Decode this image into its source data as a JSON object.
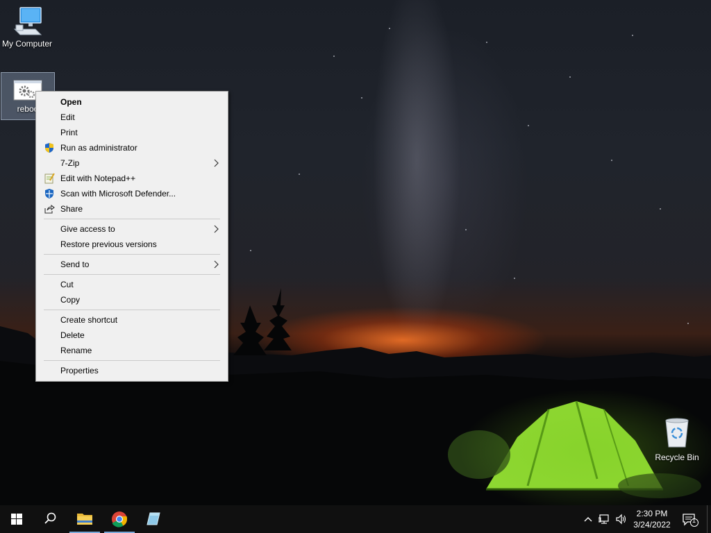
{
  "desktop": {
    "icons": [
      {
        "label": "My Computer",
        "icon": "computer-icon"
      },
      {
        "label": "reboo",
        "icon": "batch-file-gears-icon"
      },
      {
        "label": "Recycle Bin",
        "icon": "recycle-bin-icon"
      }
    ]
  },
  "context_menu": {
    "groups": [
      [
        {
          "label": "Open",
          "bold": true
        },
        {
          "label": "Edit"
        },
        {
          "label": "Print"
        },
        {
          "label": "Run as administrator",
          "icon": "uac-shield-icon"
        },
        {
          "label": "7-Zip",
          "submenu": true
        },
        {
          "label": "Edit with Notepad++",
          "icon": "notepad-plus-plus-icon"
        },
        {
          "label": "Scan with Microsoft Defender...",
          "icon": "defender-shield-icon"
        },
        {
          "label": "Share",
          "icon": "share-icon"
        }
      ],
      [
        {
          "label": "Give access to",
          "submenu": true
        },
        {
          "label": "Restore previous versions"
        }
      ],
      [
        {
          "label": "Send to",
          "submenu": true
        }
      ],
      [
        {
          "label": "Cut"
        },
        {
          "label": "Copy"
        }
      ],
      [
        {
          "label": "Create shortcut"
        },
        {
          "label": "Delete"
        },
        {
          "label": "Rename"
        }
      ],
      [
        {
          "label": "Properties"
        }
      ]
    ]
  },
  "taskbar": {
    "buttons": [
      {
        "name": "start-button",
        "icon": "windows-logo-icon"
      },
      {
        "name": "search-button",
        "icon": "search-icon"
      },
      {
        "name": "file-explorer-button",
        "icon": "folder-icon",
        "active": true
      },
      {
        "name": "chrome-button",
        "icon": "chrome-icon",
        "active": true
      },
      {
        "name": "app-button",
        "icon": "app-icon"
      }
    ],
    "tray": {
      "icons": [
        "chevron-up-icon",
        "network-icon",
        "volume-icon"
      ],
      "time": "2:30 PM",
      "date": "3/24/2022",
      "notification_count": "1"
    }
  },
  "colors": {
    "menu_bg": "#f0f0f0",
    "taskbar_bg": "#101010",
    "accent": "#7aa9d9"
  }
}
